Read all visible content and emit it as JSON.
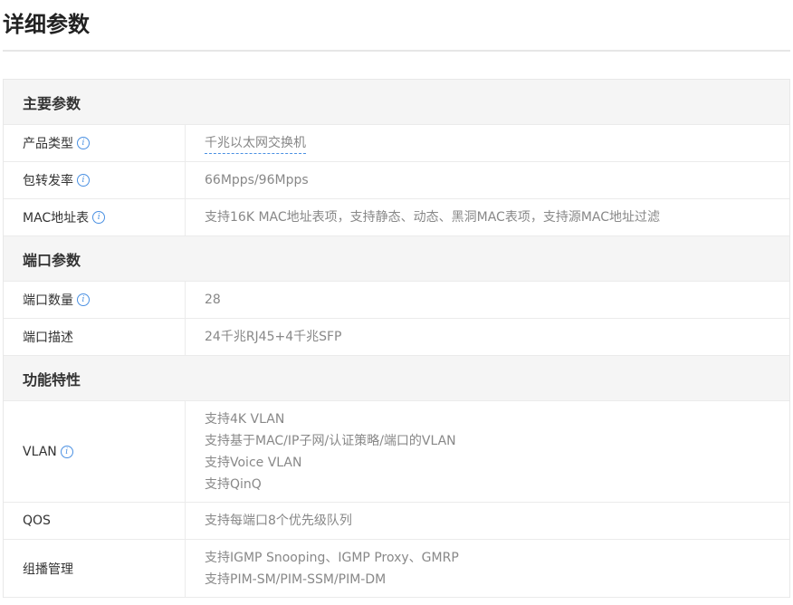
{
  "page": {
    "title": "详细参数"
  },
  "sections": [
    {
      "title": "主要参数",
      "rows": [
        {
          "label": "产品类型",
          "value": [
            "千兆以太网交换机"
          ]
        },
        {
          "label": "包转发率",
          "value": [
            "66Mpps/96Mpps"
          ]
        },
        {
          "label": "MAC地址表",
          "value": [
            "支持16K MAC地址表项，支持静态、动态、黑洞MAC表项，支持源MAC地址过滤"
          ]
        }
      ]
    },
    {
      "title": "端口参数",
      "rows": [
        {
          "label": "端口数量",
          "value": [
            "28"
          ]
        },
        {
          "label": "端口描述",
          "value": [
            "24千兆RJ45+4千兆SFP"
          ]
        }
      ]
    },
    {
      "title": "功能特性",
      "rows": [
        {
          "label": "VLAN",
          "value": [
            "支持4K VLAN",
            "支持基于MAC/IP子网/认证策略/端口的VLAN",
            "支持Voice VLAN",
            "支持QinQ"
          ]
        },
        {
          "label": "QOS",
          "value": [
            "支持每端口8个优先级队列"
          ]
        },
        {
          "label": "组播管理",
          "value": [
            "支持IGMP Snooping、IGMP Proxy、GMRP",
            "支持PIM-SM/PIM-SSM/PIM-DM"
          ]
        }
      ]
    }
  ],
  "icons": {
    "info": "info-icon"
  },
  "colors": {
    "accent": "#4a90e2",
    "section_bg": "#f5f5f5",
    "value_text": "#888888"
  }
}
